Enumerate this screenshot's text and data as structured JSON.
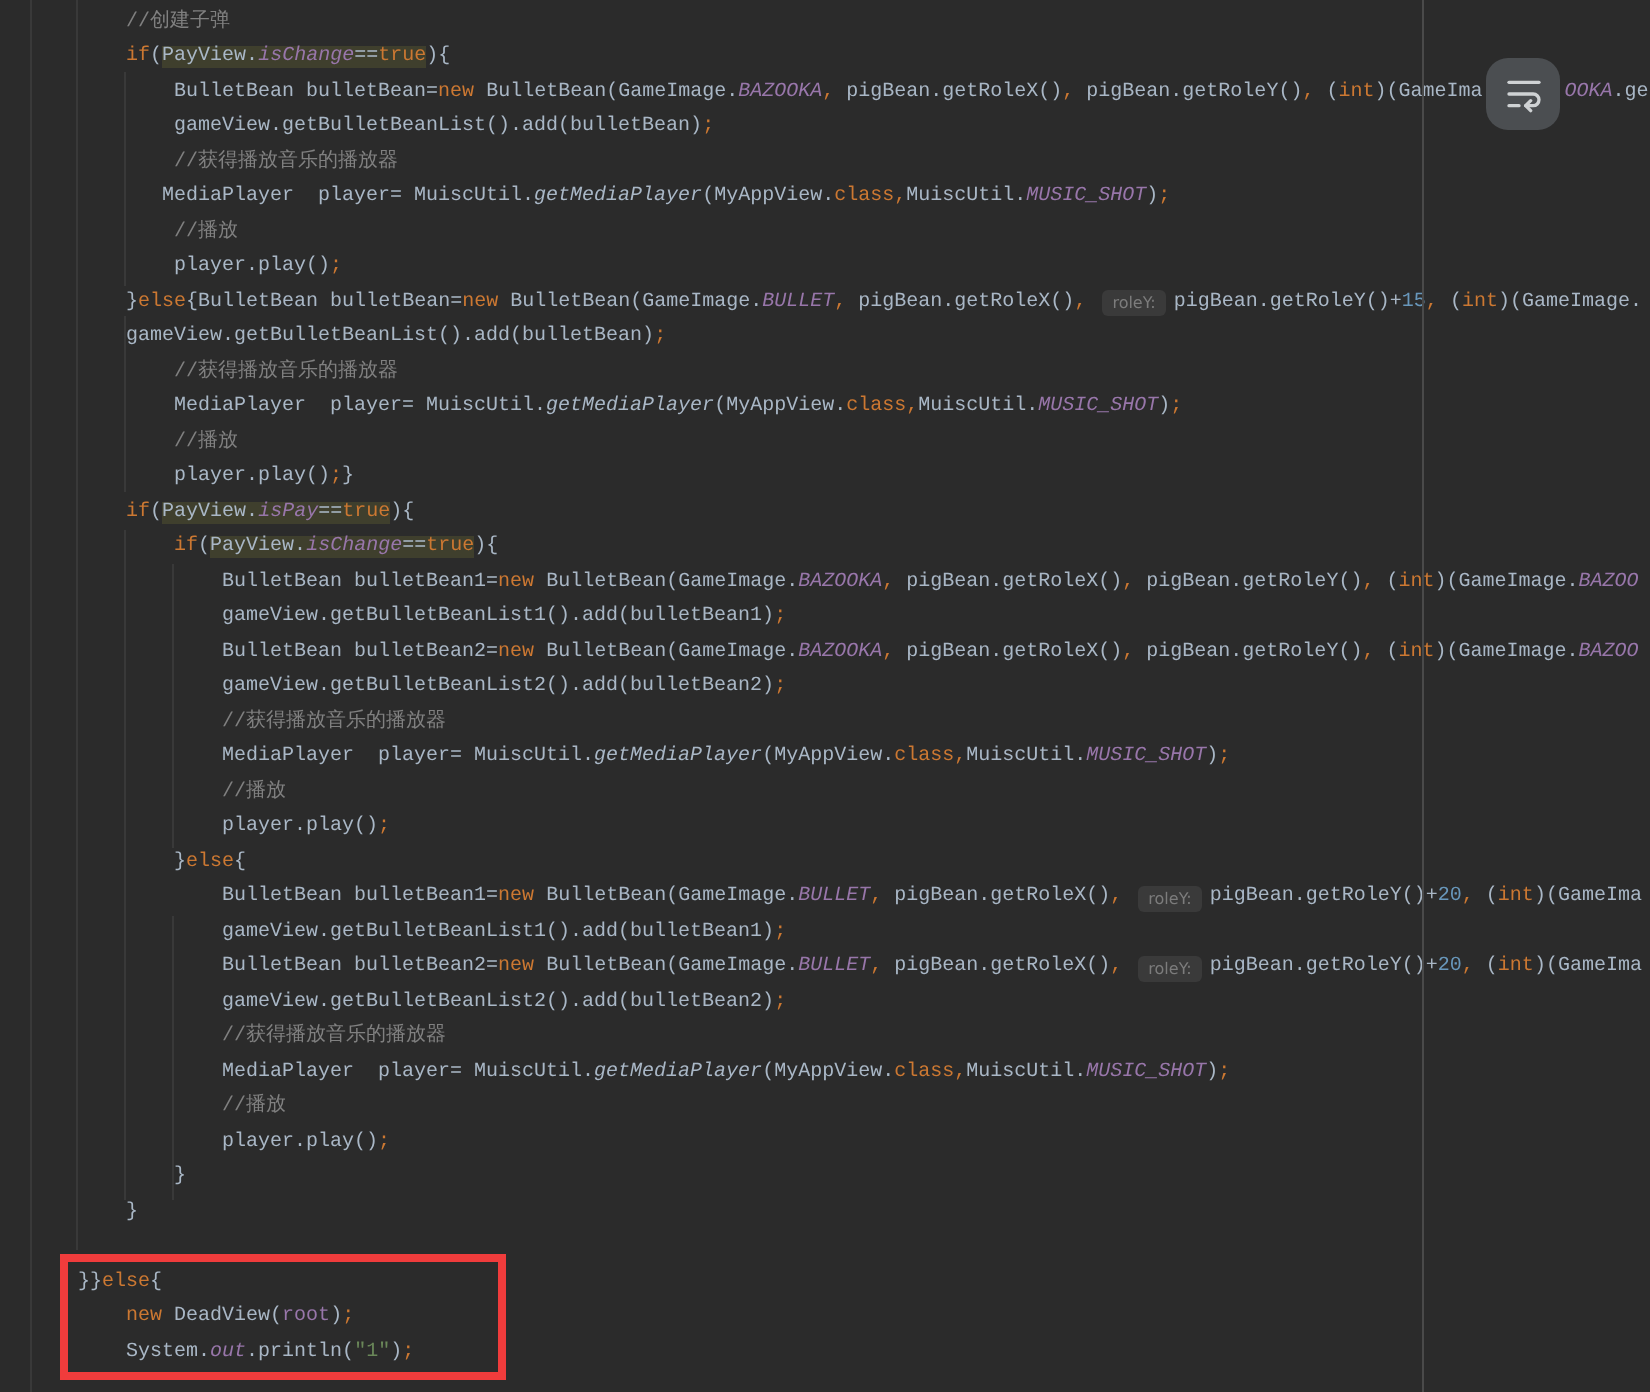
{
  "editor": {
    "lines": [
      {
        "tokens": [
          {
            "kind": "comment",
            "text": "    //创建子弹"
          }
        ]
      },
      {
        "tokens": [
          {
            "kind": "keyword",
            "text": "    if"
          },
          {
            "kind": "plain",
            "text": "("
          },
          {
            "kind": "match",
            "parts": [
              {
                "kind": "plain",
                "text": "PayView."
              },
              {
                "kind": "field",
                "text": "isChange"
              },
              {
                "kind": "plain",
                "text": "=="
              },
              {
                "kind": "keyword",
                "text": "true"
              }
            ]
          },
          {
            "kind": "plain",
            "text": "){"
          }
        ]
      },
      {
        "tokens": [
          {
            "kind": "plain",
            "text": "        BulletBean bulletBean="
          },
          {
            "kind": "keyword",
            "text": "new"
          },
          {
            "kind": "plain",
            "text": " BulletBean(GameImage."
          },
          {
            "kind": "field",
            "text": "BAZOOKA"
          },
          {
            "kind": "keyword",
            "text": ","
          },
          {
            "kind": "plain",
            "text": " pigBean.getRoleX()"
          },
          {
            "kind": "keyword",
            "text": ","
          },
          {
            "kind": "plain",
            "text": " pigBean.getRoleY()"
          },
          {
            "kind": "keyword",
            "text": ","
          },
          {
            "kind": "plain",
            "text": " ("
          },
          {
            "kind": "keyword",
            "text": "int"
          },
          {
            "kind": "plain",
            "text": ")(GameIma"
          },
          {
            "kind": "wrap_button"
          },
          {
            "kind": "field",
            "text": "OOKA"
          },
          {
            "kind": "plain",
            "text": ".ge"
          }
        ]
      },
      {
        "tokens": [
          {
            "kind": "plain",
            "text": "        gameView.getBulletBeanList().add(bulletBean)"
          },
          {
            "kind": "keyword",
            "text": ";"
          }
        ]
      },
      {
        "tokens": [
          {
            "kind": "comment",
            "text": "        //获得播放音乐的播放器"
          }
        ]
      },
      {
        "tokens": [
          {
            "kind": "plain",
            "text": "       MediaPlayer  player= MuiscUtil."
          },
          {
            "kind": "static",
            "text": "getMediaPlayer"
          },
          {
            "kind": "plain",
            "text": "(MyAppView."
          },
          {
            "kind": "keyword",
            "text": "class,"
          },
          {
            "kind": "plain",
            "text": "MuiscUtil."
          },
          {
            "kind": "field",
            "text": "MUSIC_SHOT"
          },
          {
            "kind": "plain",
            "text": ")"
          },
          {
            "kind": "keyword",
            "text": ";"
          }
        ]
      },
      {
        "tokens": [
          {
            "kind": "comment",
            "text": "        //播放"
          }
        ]
      },
      {
        "tokens": [
          {
            "kind": "plain",
            "text": "        player.play()"
          },
          {
            "kind": "keyword",
            "text": ";"
          }
        ]
      },
      {
        "tokens": [
          {
            "kind": "plain",
            "text": "    }"
          },
          {
            "kind": "keyword",
            "text": "else"
          },
          {
            "kind": "plain",
            "text": "{BulletBean bulletBean="
          },
          {
            "kind": "keyword",
            "text": "new"
          },
          {
            "kind": "plain",
            "text": " BulletBean(GameImage."
          },
          {
            "kind": "field",
            "text": "BULLET"
          },
          {
            "kind": "keyword",
            "text": ","
          },
          {
            "kind": "plain",
            "text": " pigBean.getRoleX()"
          },
          {
            "kind": "keyword",
            "text": ","
          },
          {
            "kind": "hint",
            "text": "roleY:"
          },
          {
            "kind": "plain",
            "text": "pigBean.getRoleY()+"
          },
          {
            "kind": "number",
            "text": "15"
          },
          {
            "kind": "keyword",
            "text": ","
          },
          {
            "kind": "plain",
            "text": " ("
          },
          {
            "kind": "keyword",
            "text": "int"
          },
          {
            "kind": "plain",
            "text": ")(GameImage."
          }
        ]
      },
      {
        "tokens": [
          {
            "kind": "plain",
            "text": "    gameView.getBulletBeanList().add(bulletBean)"
          },
          {
            "kind": "keyword",
            "text": ";"
          }
        ]
      },
      {
        "tokens": [
          {
            "kind": "comment",
            "text": "        //获得播放音乐的播放器"
          }
        ]
      },
      {
        "tokens": [
          {
            "kind": "plain",
            "text": "        MediaPlayer  player= MuiscUtil."
          },
          {
            "kind": "static",
            "text": "getMediaPlayer"
          },
          {
            "kind": "plain",
            "text": "(MyAppView."
          },
          {
            "kind": "keyword",
            "text": "class,"
          },
          {
            "kind": "plain",
            "text": "MuiscUtil."
          },
          {
            "kind": "field",
            "text": "MUSIC_SHOT"
          },
          {
            "kind": "plain",
            "text": ")"
          },
          {
            "kind": "keyword",
            "text": ";"
          }
        ]
      },
      {
        "tokens": [
          {
            "kind": "comment",
            "text": "        //播放"
          }
        ]
      },
      {
        "tokens": [
          {
            "kind": "plain",
            "text": "        player.play()"
          },
          {
            "kind": "keyword",
            "text": ";"
          },
          {
            "kind": "plain",
            "text": "}"
          }
        ]
      },
      {
        "tokens": [
          {
            "kind": "keyword",
            "text": "    if"
          },
          {
            "kind": "plain",
            "text": "("
          },
          {
            "kind": "match",
            "parts": [
              {
                "kind": "plain",
                "text": "PayView."
              },
              {
                "kind": "field",
                "text": "isPay"
              },
              {
                "kind": "plain",
                "text": "=="
              },
              {
                "kind": "keyword",
                "text": "true"
              }
            ]
          },
          {
            "kind": "plain",
            "text": "){"
          }
        ]
      },
      {
        "tokens": [
          {
            "kind": "keyword",
            "text": "        if"
          },
          {
            "kind": "plain",
            "text": "("
          },
          {
            "kind": "match",
            "parts": [
              {
                "kind": "plain",
                "text": "PayView."
              },
              {
                "kind": "field",
                "text": "isChange"
              },
              {
                "kind": "plain",
                "text": "=="
              },
              {
                "kind": "keyword",
                "text": "true"
              }
            ]
          },
          {
            "kind": "plain",
            "text": "){"
          }
        ]
      },
      {
        "tokens": [
          {
            "kind": "plain",
            "text": "            BulletBean bulletBean1="
          },
          {
            "kind": "keyword",
            "text": "new"
          },
          {
            "kind": "plain",
            "text": " BulletBean(GameImage."
          },
          {
            "kind": "field",
            "text": "BAZOOKA"
          },
          {
            "kind": "keyword",
            "text": ","
          },
          {
            "kind": "plain",
            "text": " pigBean.getRoleX()"
          },
          {
            "kind": "keyword",
            "text": ","
          },
          {
            "kind": "plain",
            "text": " pigBean.getRoleY()"
          },
          {
            "kind": "keyword",
            "text": ","
          },
          {
            "kind": "plain",
            "text": " ("
          },
          {
            "kind": "keyword",
            "text": "int"
          },
          {
            "kind": "plain",
            "text": ")(GameImage."
          },
          {
            "kind": "field",
            "text": "BAZOO"
          }
        ]
      },
      {
        "tokens": [
          {
            "kind": "plain",
            "text": "            gameView.getBulletBeanList1().add(bulletBean1)"
          },
          {
            "kind": "keyword",
            "text": ";"
          }
        ]
      },
      {
        "tokens": [
          {
            "kind": "plain",
            "text": "            BulletBean bulletBean2="
          },
          {
            "kind": "keyword",
            "text": "new"
          },
          {
            "kind": "plain",
            "text": " BulletBean(GameImage."
          },
          {
            "kind": "field",
            "text": "BAZOOKA"
          },
          {
            "kind": "keyword",
            "text": ","
          },
          {
            "kind": "plain",
            "text": " pigBean.getRoleX()"
          },
          {
            "kind": "keyword",
            "text": ","
          },
          {
            "kind": "plain",
            "text": " pigBean.getRoleY()"
          },
          {
            "kind": "keyword",
            "text": ","
          },
          {
            "kind": "plain",
            "text": " ("
          },
          {
            "kind": "keyword",
            "text": "int"
          },
          {
            "kind": "plain",
            "text": ")(GameImage."
          },
          {
            "kind": "field",
            "text": "BAZOO"
          }
        ]
      },
      {
        "tokens": [
          {
            "kind": "plain",
            "text": "            gameView.getBulletBeanList2().add(bulletBean2)"
          },
          {
            "kind": "keyword",
            "text": ";"
          }
        ]
      },
      {
        "tokens": [
          {
            "kind": "comment",
            "text": "            //获得播放音乐的播放器"
          }
        ]
      },
      {
        "tokens": [
          {
            "kind": "plain",
            "text": "            MediaPlayer  player= MuiscUtil."
          },
          {
            "kind": "static",
            "text": "getMediaPlayer"
          },
          {
            "kind": "plain",
            "text": "(MyAppView."
          },
          {
            "kind": "keyword",
            "text": "class,"
          },
          {
            "kind": "plain",
            "text": "MuiscUtil."
          },
          {
            "kind": "field",
            "text": "MUSIC_SHOT"
          },
          {
            "kind": "plain",
            "text": ")"
          },
          {
            "kind": "keyword",
            "text": ";"
          }
        ]
      },
      {
        "tokens": [
          {
            "kind": "comment",
            "text": "            //播放"
          }
        ]
      },
      {
        "tokens": [
          {
            "kind": "plain",
            "text": "            player.play()"
          },
          {
            "kind": "keyword",
            "text": ";"
          }
        ]
      },
      {
        "tokens": [
          {
            "kind": "plain",
            "text": "        }"
          },
          {
            "kind": "keyword",
            "text": "else"
          },
          {
            "kind": "plain",
            "text": "{"
          }
        ]
      },
      {
        "tokens": [
          {
            "kind": "plain",
            "text": "            BulletBean bulletBean1="
          },
          {
            "kind": "keyword",
            "text": "new"
          },
          {
            "kind": "plain",
            "text": " BulletBean(GameImage."
          },
          {
            "kind": "field",
            "text": "BULLET"
          },
          {
            "kind": "keyword",
            "text": ","
          },
          {
            "kind": "plain",
            "text": " pigBean.getRoleX()"
          },
          {
            "kind": "keyword",
            "text": ","
          },
          {
            "kind": "hint",
            "text": "roleY:"
          },
          {
            "kind": "plain",
            "text": "pigBean.getRoleY()+"
          },
          {
            "kind": "number",
            "text": "20"
          },
          {
            "kind": "keyword",
            "text": ","
          },
          {
            "kind": "plain",
            "text": " ("
          },
          {
            "kind": "keyword",
            "text": "int"
          },
          {
            "kind": "plain",
            "text": ")(GameIma"
          }
        ]
      },
      {
        "tokens": [
          {
            "kind": "plain",
            "text": "            gameView.getBulletBeanList1().add(bulletBean1)"
          },
          {
            "kind": "keyword",
            "text": ";"
          }
        ]
      },
      {
        "tokens": [
          {
            "kind": "plain",
            "text": "            BulletBean bulletBean2="
          },
          {
            "kind": "keyword",
            "text": "new"
          },
          {
            "kind": "plain",
            "text": " BulletBean(GameImage."
          },
          {
            "kind": "field",
            "text": "BULLET"
          },
          {
            "kind": "keyword",
            "text": ","
          },
          {
            "kind": "plain",
            "text": " pigBean.getRoleX()"
          },
          {
            "kind": "keyword",
            "text": ","
          },
          {
            "kind": "hint",
            "text": "roleY:"
          },
          {
            "kind": "plain",
            "text": "pigBean.getRoleY()+"
          },
          {
            "kind": "number",
            "text": "20"
          },
          {
            "kind": "keyword",
            "text": ","
          },
          {
            "kind": "plain",
            "text": " ("
          },
          {
            "kind": "keyword",
            "text": "int"
          },
          {
            "kind": "plain",
            "text": ")(GameIma"
          }
        ]
      },
      {
        "tokens": [
          {
            "kind": "plain",
            "text": "            gameView.getBulletBeanList2().add(bulletBean2)"
          },
          {
            "kind": "keyword",
            "text": ";"
          }
        ]
      },
      {
        "tokens": [
          {
            "kind": "comment",
            "text": "            //获得播放音乐的播放器"
          }
        ]
      },
      {
        "tokens": [
          {
            "kind": "plain",
            "text": "            MediaPlayer  player= MuiscUtil."
          },
          {
            "kind": "static",
            "text": "getMediaPlayer"
          },
          {
            "kind": "plain",
            "text": "(MyAppView."
          },
          {
            "kind": "keyword",
            "text": "class,"
          },
          {
            "kind": "plain",
            "text": "MuiscUtil."
          },
          {
            "kind": "field",
            "text": "MUSIC_SHOT"
          },
          {
            "kind": "plain",
            "text": ")"
          },
          {
            "kind": "keyword",
            "text": ";"
          }
        ]
      },
      {
        "tokens": [
          {
            "kind": "comment",
            "text": "            //播放"
          }
        ]
      },
      {
        "tokens": [
          {
            "kind": "plain",
            "text": "            player.play()"
          },
          {
            "kind": "keyword",
            "text": ";"
          }
        ]
      },
      {
        "tokens": [
          {
            "kind": "plain",
            "text": "        }"
          }
        ]
      },
      {
        "tokens": [
          {
            "kind": "plain",
            "text": "    }"
          }
        ]
      }
    ],
    "boxed_lines": [
      {
        "tokens": [
          {
            "kind": "plain",
            "text": "}}"
          },
          {
            "kind": "keyword",
            "text": "else"
          },
          {
            "kind": "plain",
            "text": "{"
          }
        ]
      },
      {
        "tokens": [
          {
            "kind": "keyword",
            "text": "    new"
          },
          {
            "kind": "plain",
            "text": " DeadView("
          },
          {
            "kind": "var",
            "text": "root"
          },
          {
            "kind": "plain",
            "text": ")"
          },
          {
            "kind": "keyword",
            "text": ";"
          }
        ]
      },
      {
        "tokens": [
          {
            "kind": "plain",
            "text": "    System."
          },
          {
            "kind": "field",
            "text": "out"
          },
          {
            "kind": "plain",
            "text": ".println("
          },
          {
            "kind": "string",
            "text": "\"1\""
          },
          {
            "kind": "plain",
            "text": ")"
          },
          {
            "kind": "keyword",
            "text": ";"
          }
        ]
      }
    ]
  }
}
